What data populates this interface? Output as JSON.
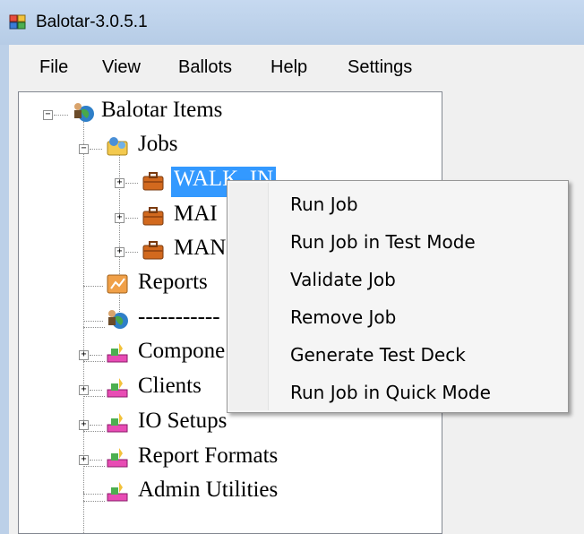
{
  "window": {
    "title": "Balotar-3.0.5.1"
  },
  "menu": {
    "items": [
      "File",
      "View",
      "Ballots",
      "Help",
      "Settings"
    ]
  },
  "tree": {
    "root": {
      "label": "Balotar Items",
      "icon": "globe-people-icon",
      "expanded": true
    },
    "jobs": {
      "label": "Jobs",
      "icon": "jobs-folder-icon",
      "expanded": true
    },
    "job_items": [
      {
        "label": "WALK_IN",
        "icon": "briefcase-icon",
        "selected": true
      },
      {
        "label": "MAI",
        "icon": "briefcase-icon",
        "selected": false
      },
      {
        "label": "MAN",
        "icon": "briefcase-icon",
        "selected": false
      }
    ],
    "reports": {
      "label": "Reports",
      "icon": "reports-icon"
    },
    "separator_item": {
      "label": "-----------",
      "icon": "globe-people-icon"
    },
    "groups": [
      {
        "label": "Compone",
        "icon": "components-icon"
      },
      {
        "label": "Clients",
        "icon": "clients-icon"
      },
      {
        "label": "IO Setups",
        "icon": "io-setups-icon"
      },
      {
        "label": "Report Formats",
        "icon": "report-formats-icon"
      },
      {
        "label": "Admin Utilities",
        "icon": "admin-utilities-icon"
      }
    ]
  },
  "context_menu": {
    "items": [
      "Run Job",
      "Run Job in Test Mode",
      "Validate Job",
      "Remove Job",
      "Generate Test Deck",
      "Run Job in Quick Mode"
    ]
  },
  "colors": {
    "selection": "#3399ff",
    "titlebar": "#c6d9f0",
    "menu_bg": "#f5f5f5"
  }
}
